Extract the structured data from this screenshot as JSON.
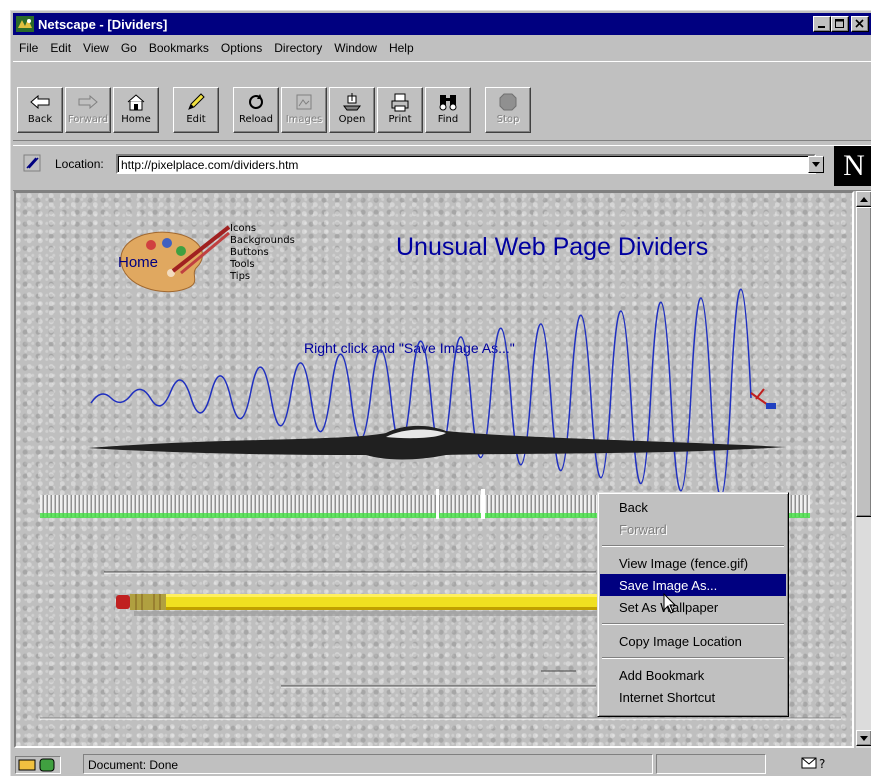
{
  "window": {
    "title": "Netscape - [Dividers]"
  },
  "menubar": {
    "items": [
      "File",
      "Edit",
      "View",
      "Go",
      "Bookmarks",
      "Options",
      "Directory",
      "Window",
      "Help"
    ]
  },
  "toolbar": {
    "buttons": [
      {
        "label": "Back",
        "icon": "back-arrow-icon",
        "enabled": true
      },
      {
        "label": "Forward",
        "icon": "forward-arrow-icon",
        "enabled": false
      },
      {
        "label": "Home",
        "icon": "home-icon",
        "enabled": true
      },
      {
        "label": "Edit",
        "icon": "pencil-icon",
        "enabled": true
      },
      {
        "label": "Reload",
        "icon": "reload-icon",
        "enabled": true
      },
      {
        "label": "Images",
        "icon": "images-icon",
        "enabled": false
      },
      {
        "label": "Open",
        "icon": "open-icon",
        "enabled": true
      },
      {
        "label": "Print",
        "icon": "print-icon",
        "enabled": true
      },
      {
        "label": "Find",
        "icon": "find-icon",
        "enabled": true
      },
      {
        "label": "Stop",
        "icon": "stop-icon",
        "enabled": false
      }
    ]
  },
  "location": {
    "label": "Location:",
    "url": "http://pixelplace.com/dividers.htm",
    "logo": "N"
  },
  "page": {
    "home_label": "Home",
    "nav_links": [
      "Icons",
      "Backgrounds",
      "Buttons",
      "Tools",
      "Tips"
    ],
    "title": "Unusual Web Page Dividers",
    "subtitle": "Right click and \"Save Image As...\""
  },
  "context_menu": {
    "items": [
      {
        "label": "Back",
        "enabled": true
      },
      {
        "label": "Forward",
        "enabled": false
      },
      {
        "label": "View Image (fence.gif)",
        "enabled": true
      },
      {
        "label": "Save Image As...",
        "enabled": true,
        "highlighted": true
      },
      {
        "label": "Set As Wallpaper",
        "enabled": true
      },
      {
        "label": "Copy Image Location",
        "enabled": true
      },
      {
        "label": "Add Bookmark",
        "enabled": true
      },
      {
        "label": "Internet Shortcut",
        "enabled": true
      }
    ]
  },
  "statusbar": {
    "text": "Document: Done"
  },
  "colors": {
    "titlebar": "#000080",
    "link_blue": "#0000a0",
    "chrome": "#c0c0c0"
  }
}
